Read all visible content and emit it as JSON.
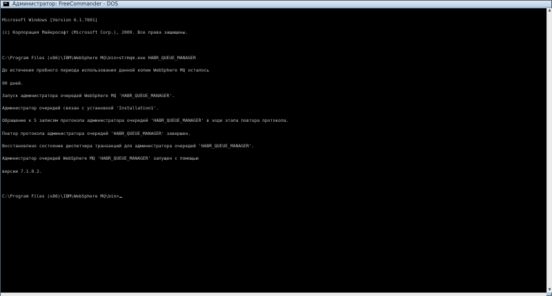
{
  "window": {
    "title": "Администратор: FreeCommander - DOS"
  },
  "console": {
    "lines": [
      "Microsoft Windows [Version 6.1.7601]",
      "(c) Корпорация Майкрософт (Microsoft Corp.), 2009. Все права защищены.",
      "",
      "C:\\Program Files (x86)\\IBM\\WebSphere MQ\\bin>strmqm.exe HABR_QUEUE_MANAGER",
      "До истечения пробного периода использования данной копии WebSphere MQ осталось",
      "90 дней.",
      "Запуск администратора очередей WebSphere MQ 'HABR_QUEUE_MANAGER'.",
      "Администратор очередей связан с установкой 'Installation1'.",
      "Обращение к 5 записям протокола администратора очередей 'HABR_QUEUE_MANAGER' в ходе этапа повтора протокола.",
      "Повтор протокола администратора очередей 'HABR_QUEUE_MANAGER' завершен.",
      "Восстановлено состояние диспетчера транзакций для администратора очередей 'HABR_QUEUE_MANAGER'.",
      "Администратор очередей WebSphere MQ 'HABR_QUEUE_MANAGER' запущен с помощью",
      "версии 7.1.0.2.",
      "",
      "C:\\Program Files (x86)\\IBM\\WebSphere MQ\\bin>"
    ]
  },
  "icons": {
    "window_icon": "console-icon",
    "scroll_up": "scroll-up-arrow-icon",
    "scroll_down": "scroll-down-arrow-icon"
  },
  "colors": {
    "console_background": "#000000",
    "console_text": "#c0c0c0"
  }
}
